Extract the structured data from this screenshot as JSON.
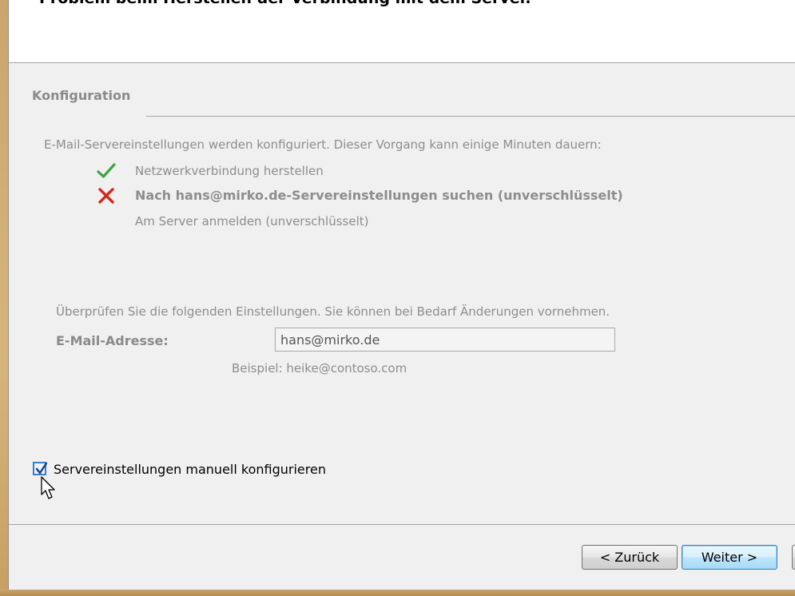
{
  "header": {
    "title": "Problem beim Herstellen der Verbindung mit dem Server."
  },
  "configuration": {
    "section_title": "Konfiguration",
    "info_text": "E-Mail-Servereinstellungen werden konfiguriert. Dieser Vorgang kann einige Minuten dauern:",
    "steps": [
      {
        "label": "Netzwerkverbindung herstellen",
        "status": "success",
        "icon": "check-icon"
      },
      {
        "label": "Nach hans@mirko.de-Servereinstellungen suchen (unverschlüsselt)",
        "status": "failed",
        "icon": "cross-icon"
      },
      {
        "label": "Am Server anmelden (unverschlüsselt)",
        "status": "pending",
        "icon": ""
      }
    ]
  },
  "verify": {
    "text": "Überprüfen Sie die folgenden Einstellungen. Sie können bei Bedarf Änderungen vornehmen.",
    "email_label": "E-Mail-Adresse:",
    "email_value": "hans@mirko.de",
    "example": "Beispiel: heike@contoso.com"
  },
  "manual": {
    "label": "Servereinstellungen manuell konfigurieren",
    "checked": true
  },
  "buttons": {
    "back": "< Zurück",
    "next": "Weiter >"
  },
  "colors": {
    "check": "#3ea63e",
    "cross": "#d9261c",
    "accent": "#3c7fb1",
    "disabled_text": "#8d8d8d"
  }
}
